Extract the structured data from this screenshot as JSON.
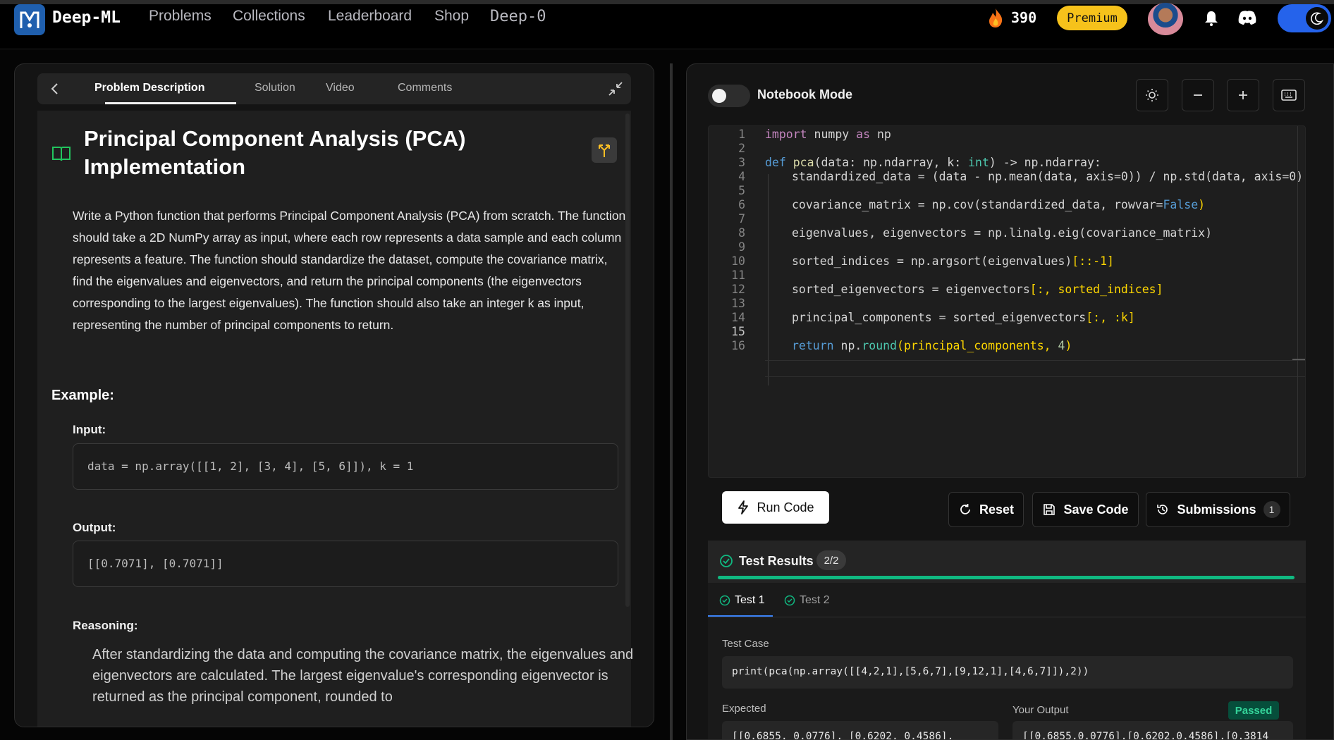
{
  "nav": {
    "logo_text": "Deep-ML",
    "links": [
      "Problems",
      "Collections",
      "Leaderboard",
      "Shop"
    ],
    "deep0": "Deep-0",
    "streak": "390",
    "premium": "Premium"
  },
  "problem": {
    "tabs": [
      "Problem Description",
      "Solution",
      "Video",
      "Comments"
    ],
    "title": "Principal Component Analysis (PCA) Implementation",
    "description": "Write a Python function that performs Principal Component Analysis (PCA) from scratch. The function should take a 2D NumPy array as input, where each row represents a data sample and each column represents a feature. The function should standardize the dataset, compute the covariance matrix, find the eigenvalues and eigenvectors, and return the principal components (the eigenvectors corresponding to the largest eigenvalues). The function should also take an integer k as input, representing the number of principal components to return.",
    "example_heading": "Example:",
    "input_label": "Input:",
    "input_value": "data = np.array([[1, 2], [3, 4], [5, 6]]), k = 1",
    "output_label": "Output:",
    "output_value": "[[0.7071], [0.7071]]",
    "reasoning_label": "Reasoning:",
    "reasoning_text": "After standardizing the data and computing the covariance matrix, the eigenvalues and eigenvectors are calculated. The largest eigenvalue's corresponding eigenvector is returned as the principal component, rounded to"
  },
  "editor": {
    "notebook_label": "Notebook Mode",
    "line_numbers": [
      "1",
      "2",
      "3",
      "4",
      "5",
      "6",
      "7",
      "8",
      "9",
      "10",
      "11",
      "12",
      "13",
      "14",
      "15",
      "16"
    ],
    "code": {
      "l1_import": "import",
      "l1_mod": " numpy ",
      "l1_as": "as",
      "l1_alias": " np",
      "l3_def": "def",
      "l3_fn": " pca",
      "l3_a": "(data: np.ndarray, k: ",
      "l3_int": "int",
      "l3_b": ") -> np.ndarray:",
      "l4": "standardized_data = (data - np.mean(data, axis=0)) / np.std(data, axis=0)",
      "l6_a": "covariance_matrix = np.cov(standardized_data, rowvar=",
      "l6_false": "False",
      "l6_b": ")",
      "l8": "eigenvalues, eigenvectors = np.linalg.eig(covariance_matrix)",
      "l10_a": "sorted_indices = np.argsort(eigenvalues)",
      "l10_b": "[::-1]",
      "l12_a": "sorted_eigenvectors = eigenvectors",
      "l12_b": "[:, sorted_indices]",
      "l14_a": "principal_components = sorted_eigenvectors",
      "l14_b": "[:, :k]",
      "l16_ret": "return",
      "l16_a": " np.",
      "l16_round": "round",
      "l16_b": "(principal_components, ",
      "l16_num": "4",
      "l16_c": ")"
    }
  },
  "actions": {
    "run": "Run Code",
    "reset": "Reset",
    "save": "Save Code",
    "submissions": "Submissions",
    "submissions_count": "1"
  },
  "results": {
    "title": "Test Results",
    "count": "2/2",
    "progress": 1.0,
    "tabs": [
      "Test 1",
      "Test 2"
    ],
    "test_case_label": "Test Case",
    "test_case": "print(pca(np.array([[4,2,1],[5,6,7],[9,12,1],[4,6,7]]),2))",
    "expected_label": "Expected",
    "expected": "[[0.6855, 0.0776], [0.6202, 0.4586],",
    "output_label": "Your Output",
    "output": "[[0.6855,0.0776],[0.6202,0.4586],[0.3814",
    "status": "Passed"
  },
  "colors": {
    "accent_green": "#10b981",
    "premium_yellow": "#f6c21b",
    "toggle_blue": "#2563eb"
  }
}
